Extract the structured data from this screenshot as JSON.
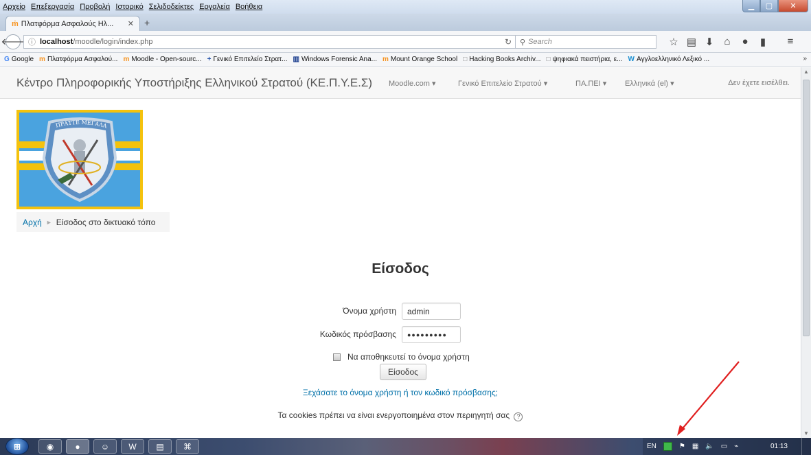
{
  "browser": {
    "menu": [
      "Αρχείο",
      "Επεξεργασία",
      "Προβολή",
      "Ιστορικό",
      "Σελιδοδείκτες",
      "Εργαλεία",
      "Βοήθεια"
    ],
    "tab_title": "Πλατφόρμα Ασφαλούς Ηλ...",
    "tab_favicon": "moodle-icon",
    "url_host": "localhost",
    "url_path": "/moodle/login/index.php",
    "search_placeholder": "Search",
    "bookmarks": [
      {
        "icon": "G",
        "label": "Google"
      },
      {
        "icon": "m",
        "label": "Πλατφόρμα Ασφαλού..."
      },
      {
        "icon": "m",
        "label": "Moodle - Open-sourc..."
      },
      {
        "icon": "+",
        "label": "Γενικό Επιτελείο Στρατ..."
      },
      {
        "icon": "▥",
        "label": "Windows Forensic Ana..."
      },
      {
        "icon": "m",
        "label": "Mount Orange School"
      },
      {
        "icon": "□",
        "label": "Hacking Books Archiv..."
      },
      {
        "icon": "□",
        "label": "ψηφιακά πειστήρια, ε..."
      },
      {
        "icon": "W",
        "label": "Αγγλοελληνικό Λεξικό ..."
      }
    ],
    "bookmarks_more": "»"
  },
  "moodle_nav": {
    "brand": "Κέντρο Πληροφορικής Υποστήριξης Ελληνικού Στρατού (ΚΕ.Π.Υ.Ε.Σ)",
    "items": [
      "Moodle.com ▾",
      "Γενικό Επιτελείο Στρατού ▾",
      "ΠΑ.ΠΕΙ ▾",
      "Ελληνικά (el) ▾"
    ],
    "logged_out": "Δεν έχετε εισέλθει."
  },
  "logo": {
    "motto": "ΠΡΑΤΤΕ ΜΕΓΑΛΑ"
  },
  "breadcrumb": {
    "home": "Αρχή",
    "separator": "►",
    "current": "Είσοδος στο δικτυακό τόπο"
  },
  "login": {
    "heading": "Είσοδος",
    "username_label": "Όνομα χρήστη",
    "username_value": "admin",
    "password_label": "Κωδικός πρόσβασης",
    "password_value": "●●●●●●●●●",
    "remember_label": "Να αποθηκευτεί το όνομα χρήστη",
    "submit_label": "Είσοδος",
    "forgot_link": "Ξεχάσατε το όνομα χρήστη ή τον κωδικό πρόσβασης;",
    "cookies_notice": "Τα cookies πρέπει να είναι ενεργοποιημένα στον περιηγητή σας"
  },
  "taskbar": {
    "language": "EN",
    "clock": "01:13"
  },
  "colors": {
    "link": "#0070a8",
    "logo_blue": "#4aa3df",
    "logo_yellow": "#f4c20d",
    "annotation_arrow": "#e02020"
  }
}
